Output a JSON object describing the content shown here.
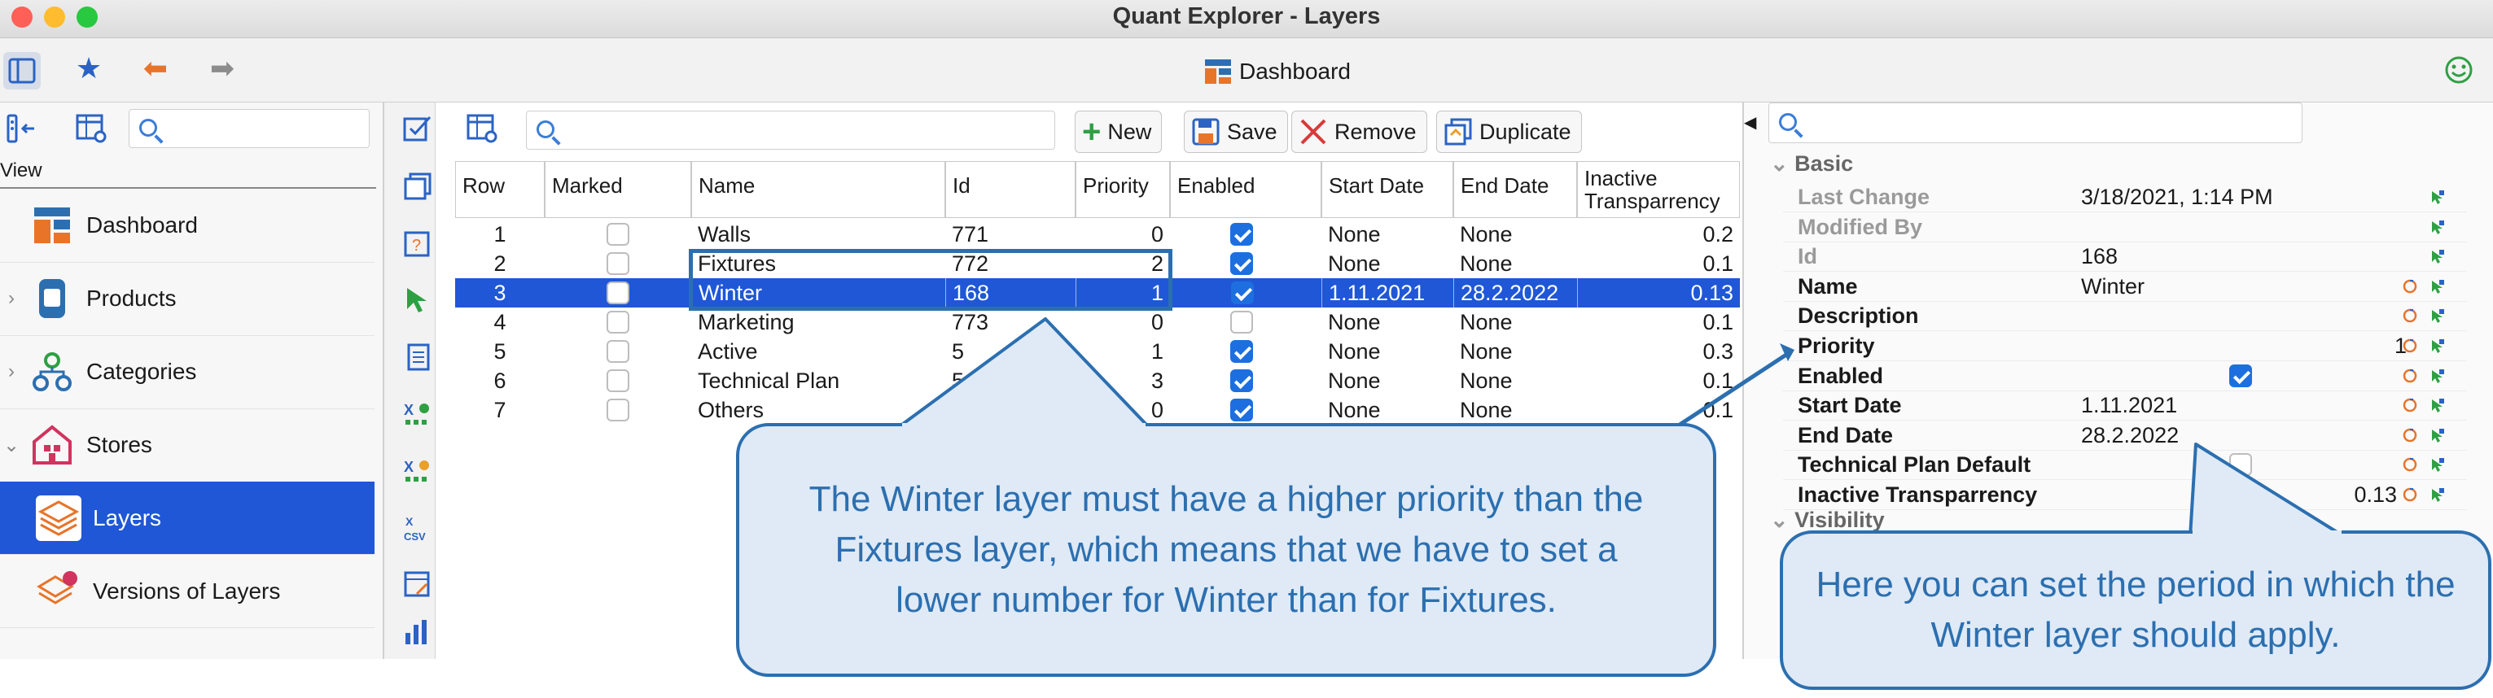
{
  "window": {
    "title": "Quant Explorer - Layers"
  },
  "toolbar": {
    "center_label": "Dashboard"
  },
  "left": {
    "view_label": "View",
    "items": [
      {
        "label": "Dashboard"
      },
      {
        "label": "Products"
      },
      {
        "label": "Categories"
      },
      {
        "label": "Stores"
      },
      {
        "label": "Layers"
      },
      {
        "label": "Versions of Layers"
      }
    ]
  },
  "actions": {
    "new": "New",
    "save": "Save",
    "remove": "Remove",
    "duplicate": "Duplicate"
  },
  "table": {
    "columns": [
      "Row",
      "Marked",
      "Name",
      "Id",
      "Priority",
      "Enabled",
      "Start Date",
      "End Date",
      "Inactive Transparrency"
    ],
    "rows": [
      {
        "row": "1",
        "name": "Walls",
        "id": "771",
        "priority": "0",
        "enabled": true,
        "start": "None",
        "end": "None",
        "trans": "0.2"
      },
      {
        "row": "2",
        "name": "Fixtures",
        "id": "772",
        "priority": "2",
        "enabled": true,
        "start": "None",
        "end": "None",
        "trans": "0.1"
      },
      {
        "row": "3",
        "name": "Winter",
        "id": "168",
        "priority": "1",
        "enabled": true,
        "start": "1.11.2021",
        "end": "28.2.2022",
        "trans": "0.13"
      },
      {
        "row": "4",
        "name": "Marketing",
        "id": "773",
        "priority": "0",
        "enabled": false,
        "start": "None",
        "end": "None",
        "trans": "0.1"
      },
      {
        "row": "5",
        "name": "Active",
        "id": "5",
        "priority": "1",
        "enabled": true,
        "start": "None",
        "end": "None",
        "trans": "0.3"
      },
      {
        "row": "6",
        "name": "Technical Plan",
        "id": "5",
        "priority": "3",
        "enabled": true,
        "start": "None",
        "end": "None",
        "trans": "0.1"
      },
      {
        "row": "7",
        "name": "Others",
        "id": "",
        "priority": "0",
        "enabled": true,
        "start": "None",
        "end": "None",
        "trans": "0.1"
      }
    ]
  },
  "props": {
    "group_basic": "Basic",
    "group_visibility": "Visibility",
    "rows": [
      {
        "label": "Last Change",
        "value": "3/18/2021, 1:14 PM"
      },
      {
        "label": "Modified By",
        "value": ""
      },
      {
        "label": "Id",
        "value": "168"
      },
      {
        "label": "Name",
        "value": "Winter"
      },
      {
        "label": "Description",
        "value": ""
      },
      {
        "label": "Priority",
        "value": "1"
      },
      {
        "label": "Enabled",
        "value": ""
      },
      {
        "label": "Start Date",
        "value": "1.11.2021"
      },
      {
        "label": "End Date",
        "value": "28.2.2022"
      },
      {
        "label": "Technical Plan Default",
        "value": ""
      },
      {
        "label": "Inactive Transparrency",
        "value": "0.13"
      }
    ]
  },
  "callouts": {
    "left": "The Winter layer must have a higher priority than the Fixtures layer, which means that we have to set a lower number for Winter than for Fixtures.",
    "right": "Here you can set the period in which the Winter layer should apply."
  },
  "colors": {
    "selection": "#1f57d6",
    "callout_border": "#2c6fb0",
    "callout_fill": "#dfeaf6"
  }
}
